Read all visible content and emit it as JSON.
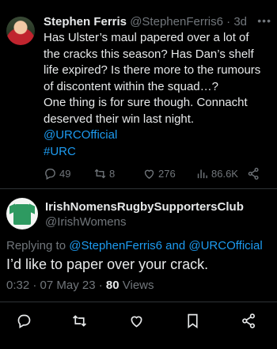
{
  "tweet": {
    "author_name": "Stephen Ferris",
    "author_handle": "@StephenFerris6",
    "separator": "·",
    "age": "3d",
    "body_lines": [
      "Has Ulster’s maul papered over a lot of",
      "the cracks this season? Has Dan’s shelf",
      "life expired? Is there more to the rumours",
      "of discontent within the squad…?",
      "One thing is for sure though. Connacht",
      "deserved their win last night."
    ],
    "mention": "@URCOfficial",
    "hashtag": "#URC",
    "stats": {
      "replies": "49",
      "retweets": "8",
      "likes": "276",
      "views": "86.6K"
    }
  },
  "reply": {
    "author_name": "IrishNomensRugbySupportersClub",
    "author_handle": "@IrishWomens",
    "replying_prefix": "Replying to",
    "replying_to_1": "@StephenFerris6",
    "replying_and": "and",
    "replying_to_2": "@URCOfficial",
    "text": "I’d like to paper over your crack.",
    "time": "0:32 · 07 May 23 ·",
    "views_count": "80",
    "views_label": "Views"
  },
  "colors": {
    "background": "#000000",
    "text": "#e7e9ea",
    "muted": "#71767b",
    "link": "#1d9bf0",
    "divider": "#2f3336"
  },
  "icons": [
    "more-icon",
    "reply-icon",
    "retweet-icon",
    "like-icon",
    "views-icon",
    "share-icon",
    "bookmark-icon"
  ]
}
